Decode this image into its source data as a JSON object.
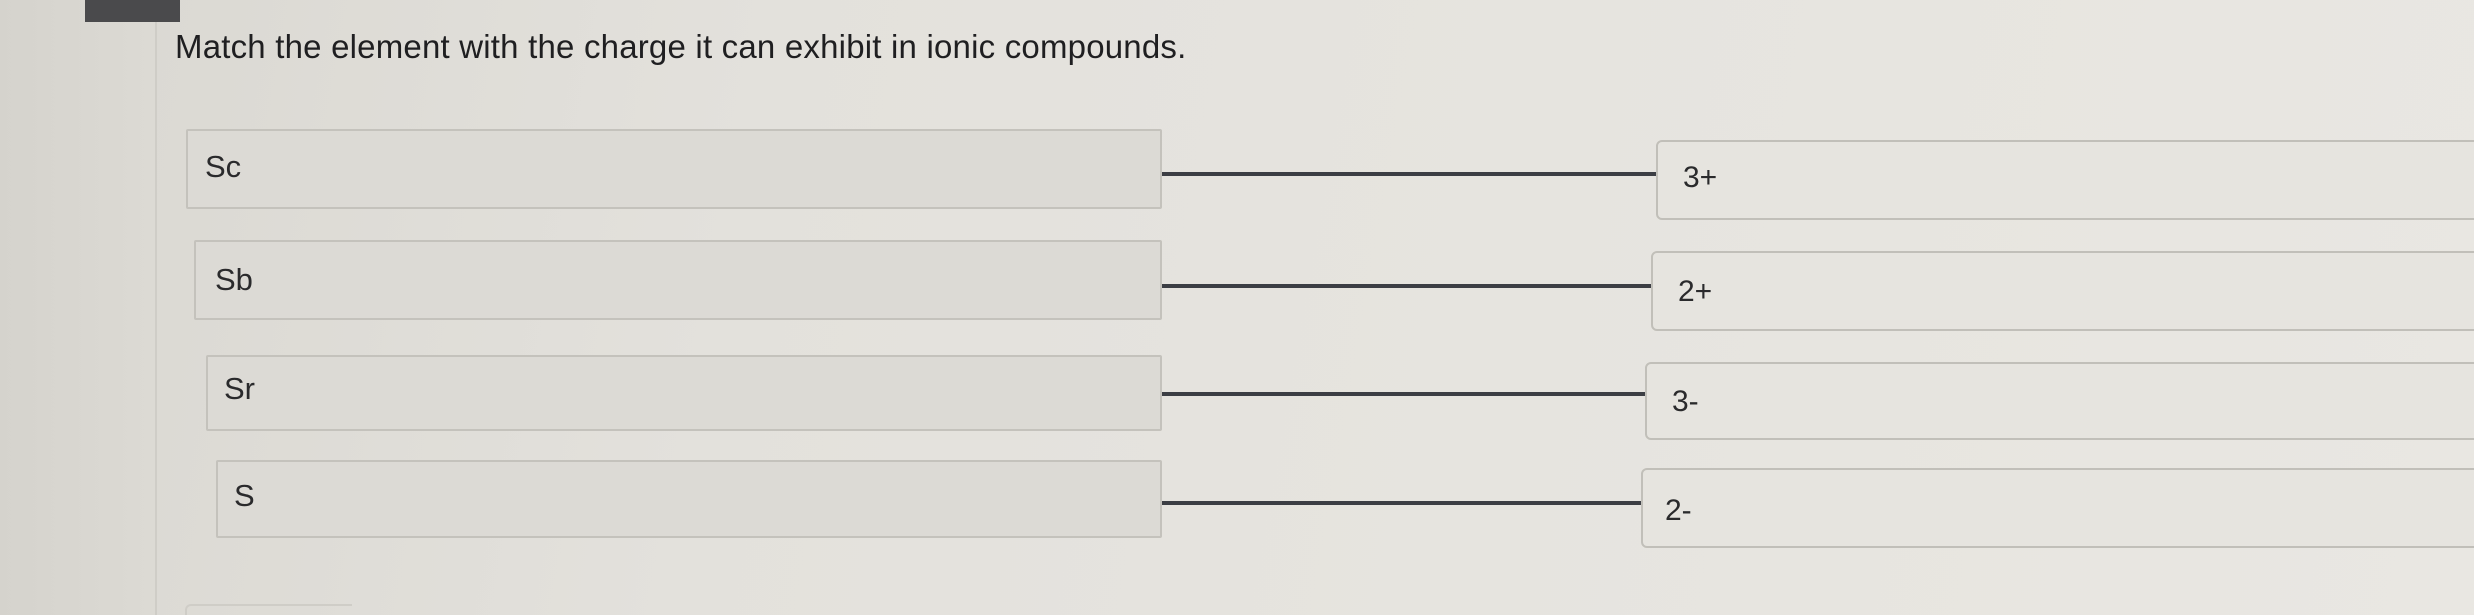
{
  "question": {
    "text": "Match the element with the charge it can exhibit in ionic compounds."
  },
  "matches": [
    {
      "element": "Sc",
      "charge": "3+"
    },
    {
      "element": "Sb",
      "charge": "2+"
    },
    {
      "element": "Sr",
      "charge": "3-"
    },
    {
      "element": "S",
      "charge": "2-"
    }
  ]
}
